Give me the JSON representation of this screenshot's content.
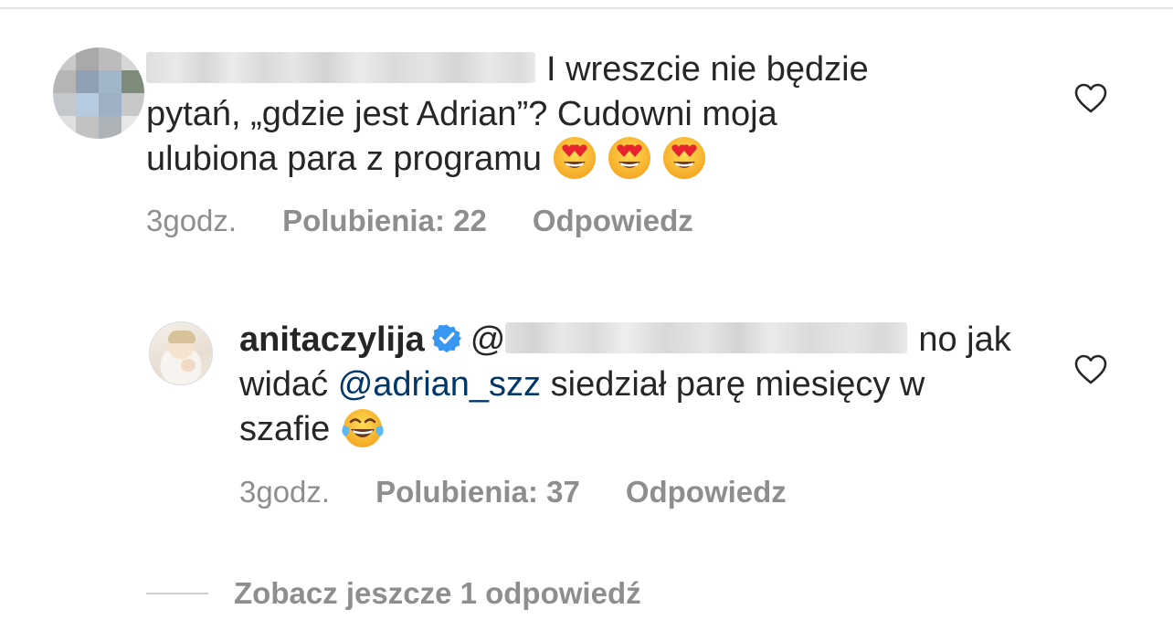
{
  "comments": [
    {
      "author_hidden": true,
      "text_line1": "I wreszcie nie będzie",
      "text_line2": "pytań, „gdzie jest Adrian”? Cudowni moja",
      "text_line3": "ulubiona para z programu",
      "emoji_icons": [
        "heart-eyes-emoji",
        "heart-eyes-emoji",
        "heart-eyes-emoji"
      ],
      "time": "3godz.",
      "likes": "Polubienia: 22",
      "reply_label": "Odpowiedz"
    }
  ],
  "reply": {
    "author": "anitaczylija",
    "verified_icon": "verified-badge-icon",
    "verified_color": "#3897f0",
    "mention_prefix": "@",
    "text_line1_end": "no jak",
    "text_line2_start": "widać ",
    "mention": "@adrian_szz",
    "text_line2_end": " siedział parę miesięcy w",
    "text_line3": "szafie",
    "emoji_icon": "tears-of-joy-emoji",
    "time": "3godz.",
    "likes": "Polubienia: 37",
    "reply_label": "Odpowiedz"
  },
  "view_more_replies": "Zobacz jeszcze 1 odpowiedź",
  "colors": {
    "text": "#262626",
    "meta": "#8e8e8e",
    "mention": "#00376b"
  }
}
